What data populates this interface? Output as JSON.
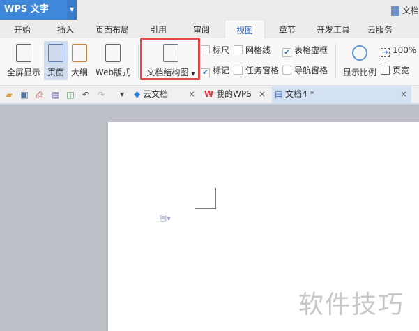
{
  "app": {
    "button_label": "WPS 文字",
    "doc_title": "文档"
  },
  "menu_tabs": [
    "开始",
    "插入",
    "页面布局",
    "引用",
    "审阅",
    "视图",
    "章节",
    "开发工具",
    "云服务"
  ],
  "active_tab": "视图",
  "ribbon": {
    "fullscreen": "全屏显示",
    "page": "页面",
    "outline": "大纲",
    "web": "Web版式",
    "doc_map": "文档结构图",
    "checkboxes": [
      {
        "label": "标尺",
        "checked": false
      },
      {
        "label": "网格线",
        "checked": false
      },
      {
        "label": "表格虚框",
        "checked": true
      },
      {
        "label": "标记",
        "checked": true
      },
      {
        "label": "任务窗格",
        "checked": false
      },
      {
        "label": "导航窗格",
        "checked": false
      }
    ],
    "zoom_label": "显示比例",
    "zoom_100": "100%",
    "page_width": "页宽"
  },
  "doc_tabs": [
    {
      "label": "云文档"
    },
    {
      "label": "我的WPS"
    },
    {
      "label": "文档4 *"
    }
  ],
  "close_glyph": "×",
  "watermark": "软件技巧",
  "colors": {
    "accent": "#3f87d9",
    "highlight": "#e04848"
  }
}
